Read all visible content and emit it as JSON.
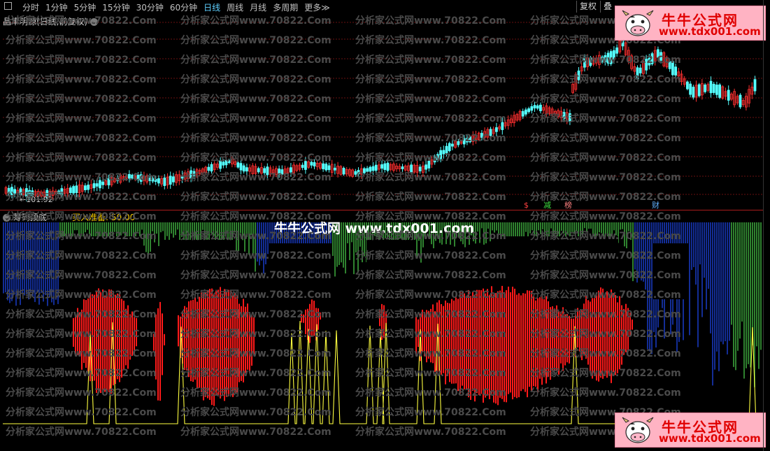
{
  "toolbar": {
    "periods": [
      "分时",
      "1分钟",
      "5分钟",
      "15分钟",
      "30分钟",
      "60分钟",
      "日线",
      "周线",
      "月线",
      "多周期",
      "更多"
    ],
    "active_period": "日线",
    "restore_btn": "复权",
    "overlay_btn": "叠"
  },
  "main_chart": {
    "stock_title": "晶丰明源(日线,前复权)",
    "low_price_label": "←101.92",
    "events": [
      {
        "label": "$",
        "color": "#ff4040"
      },
      {
        "label": "减",
        "color": "#40e040"
      },
      {
        "label": "榜",
        "color": "#ff8080"
      },
      {
        "label": "财",
        "color": "#60b0ff"
      }
    ],
    "colors": {
      "up": "#ff3030",
      "down": "#54ffff",
      "grid": "#6a1010"
    }
  },
  "indicator": {
    "name": "筹码顶底",
    "value_text": "买入准备: 50.00",
    "banner": "牛牛公式网 www.tdx001.com",
    "colors": {
      "red": "#ff1a1a",
      "blue": "#1a3cc8",
      "green": "#3fae3f",
      "yellow": "#ffff40"
    }
  },
  "watermark": {
    "text": "分析家公式网www.70822.Com",
    "color": "#4a4a4a"
  },
  "logo": {
    "title": "牛牛公式网",
    "url": "www.tdx001.com"
  }
}
